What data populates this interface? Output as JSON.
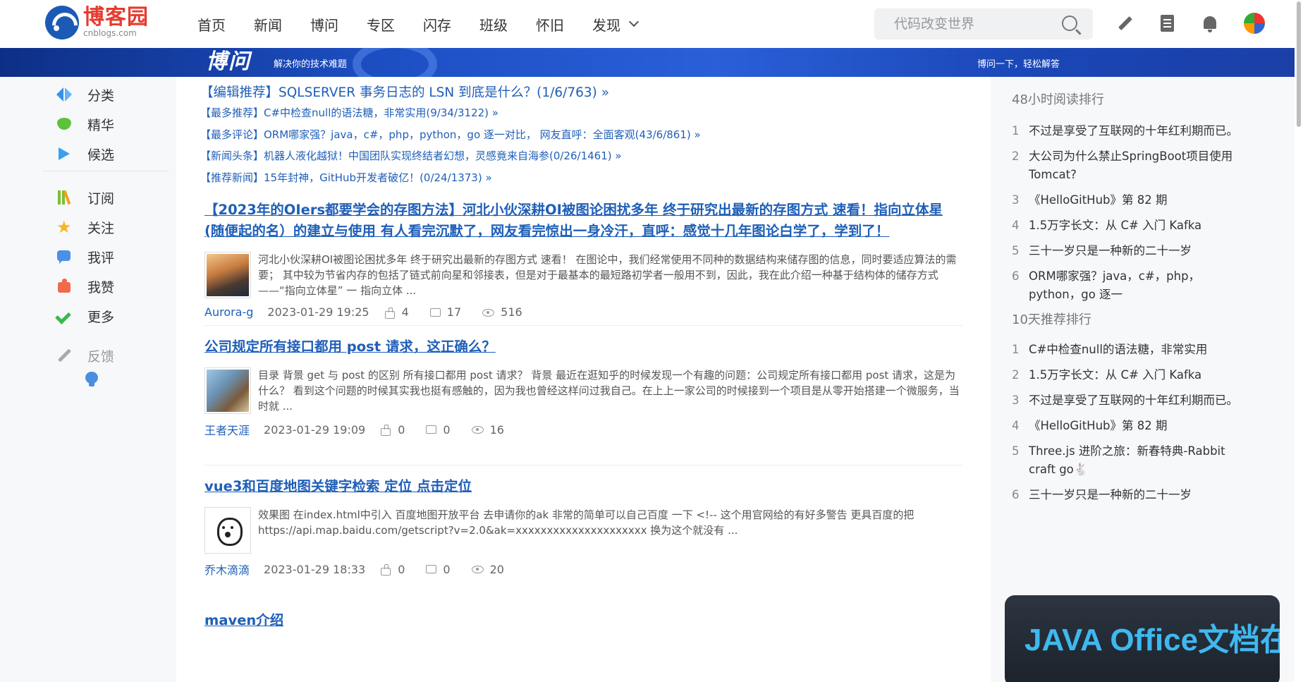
{
  "header": {
    "logo_cn": "博客园",
    "logo_en": "cnblogs.com",
    "nav": [
      "首页",
      "新闻",
      "博问",
      "专区",
      "闪存",
      "班级",
      "怀旧",
      "发现"
    ],
    "search_placeholder": "代码改变世界"
  },
  "banner": {
    "logo": "博问",
    "tagline": "解决你的技术难题",
    "right_text": "博问一下，轻松解答"
  },
  "sidebar": {
    "items": [
      "分类",
      "精华",
      "候选",
      "订阅",
      "关注",
      "我评",
      "我赞",
      "更多",
      "反馈"
    ]
  },
  "recommendations": [
    "【编辑推荐】SQLSERVER 事务日志的 LSN 到底是什么？(1/6/763) »",
    "【最多推荐】C#中检查null的语法糖，非常实用(9/34/3122) »",
    "【最多评论】ORM哪家强？java，c#，php，python，go 逐一对比， 网友直呼：全面客观(43/6/861) »",
    "【新闻头条】机器人液化越狱！中国团队实现终结者幻想，灵感竟来自海参(0/26/1461) »",
    "【推荐新闻】15年封神，GitHub开发者破亿！(0/24/1373) »"
  ],
  "posts": [
    {
      "title": "【2023年的OIers都要学会的存图方法】河北小伙深耕OI被图论困扰多年 终于研究出最新的存图方式 速看！指向立体星(随便起的名）的建立与使用 有人看完沉默了，网友看完惊出一身冷汗，直呼：感觉十几年图论白学了，学到了！",
      "summary": "河北小伙深耕OI被图论困扰多年 终于研究出最新的存图方式 速看！ 在图论中，我们经常使用不同种的数据结构来储存图的信息，同时要适应算法的需要； 其中较为节省内存的包括了链式前向星和邻接表，但是对于最基本的最短路初学者一般用不到，因此，我在此介绍一种基于结构体的储存方式——“指向立体星” 一 指向立体 ...",
      "author": "Aurora-g",
      "date": "2023-01-29 19:25",
      "likes": "4",
      "comments": "17",
      "views": "516"
    },
    {
      "title": "公司规定所有接口都用 post 请求，这正确么？",
      "summary": "目录 背景 get 与 post 的区别 所有接口都用 post 请求？ 背景 最近在逛知乎的时候发现一个有趣的问题：公司规定所有接口都用 post 请求，这是为什么？ 看到这个问题的时候其实我也挺有感触的，因为我也曾经这样问过我自己。在上上一家公司的时候接到一个项目是从零开始搭建一个微服务，当时就 ...",
      "author": "王者天涯",
      "date": "2023-01-29 19:09",
      "likes": "0",
      "comments": "0",
      "views": "16"
    },
    {
      "title": "vue3和百度地图关键字检索 定位 点击定位",
      "summary": "效果图 在index.html中引入 百度地图开放平台 去申请你的ak 非常的简单可以自己百度 一下 <!-- 这个用官网给的有好多警告 更具百度的把 https://api.map.baidu.com/getscript?v=2.0&ak=xxxxxxxxxxxxxxxxxxxxx 换为这个就没有 ...",
      "author": "乔木滴滴",
      "date": "2023-01-29 18:33",
      "likes": "0",
      "comments": "0",
      "views": "20"
    },
    {
      "title": "maven介绍"
    }
  ],
  "rank48": {
    "title": "48小时阅读排行",
    "items": [
      "不过是享受了互联网的十年红利期而已。",
      "大公司为什么禁止SpringBoot项目使用Tomcat?",
      "《HelloGitHub》第 82 期",
      "1.5万字长文：从 C# 入门 Kafka",
      "三十一岁只是一种新的二十一岁",
      "ORM哪家强？java，c#，php，python，go 逐一"
    ]
  },
  "rank10d": {
    "title": "10天推荐排行",
    "items": [
      "C#中检查null的语法糖，非常实用",
      "1.5万字长文：从 C# 入门 Kafka",
      "不过是享受了互联网的十年红利期而已。",
      "《HelloGitHub》第 82 期",
      "Three.js 进阶之旅：新春特典-Rabbit craft go🐇",
      "三十一岁只是一种新的二十一岁"
    ]
  },
  "ad": {
    "text": "JAVA Office文档在线编辑APIs"
  }
}
